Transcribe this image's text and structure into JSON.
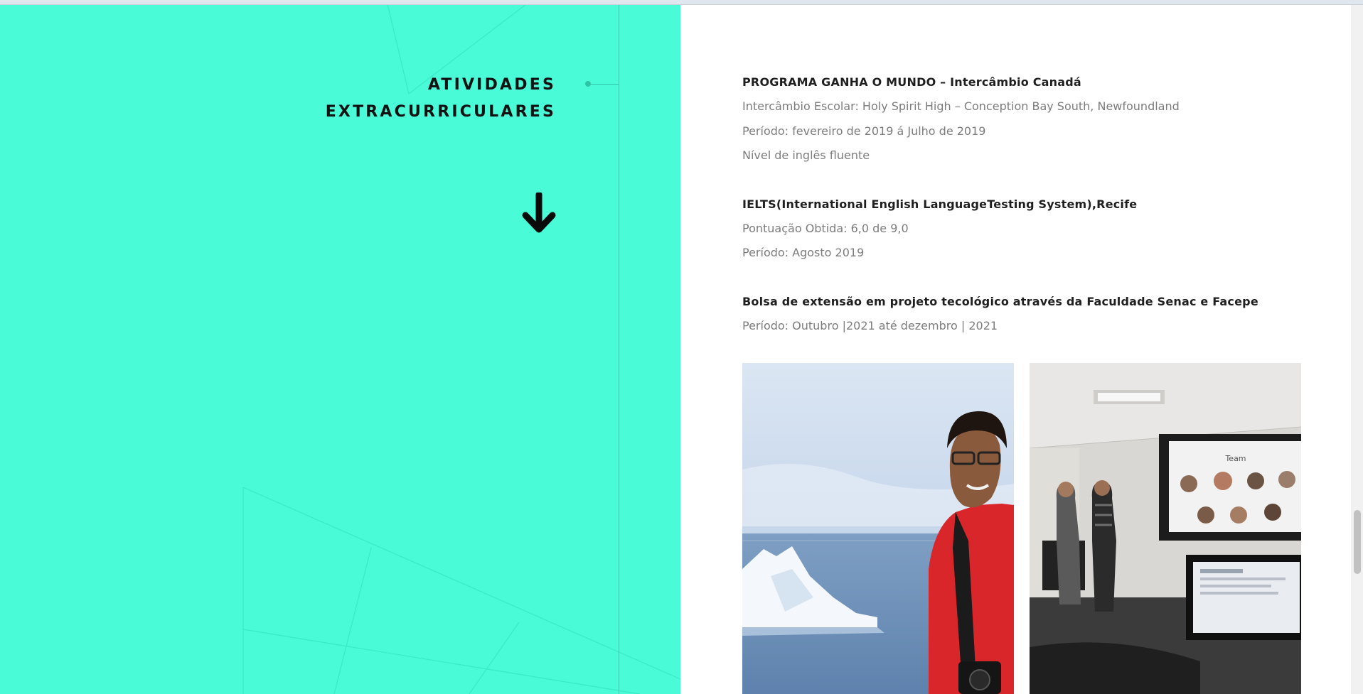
{
  "section": {
    "title_line1": "ATIVIDADES",
    "title_line2": "EXTRACURRICULARES",
    "arrow_icon": "arrow-down-icon"
  },
  "entries": [
    {
      "title": "PROGRAMA GANHA O MUNDO – Intercâmbio Canadá",
      "details": [
        "Intercâmbio Escolar: Holy Spirit High – Conception Bay South, Newfoundland",
        "Período: fevereiro de 2019 á Julho de 2019",
        "Nível de inglês fluente"
      ]
    },
    {
      "title": "IELTS(International English LanguageTesting System),Recife",
      "details": [
        "Pontuação Obtida: 6,0 de 9,0",
        "Período: Agosto 2019"
      ]
    },
    {
      "title": "Bolsa de extensão em projeto tecológico através da Faculdade Senac e Facepe",
      "details": [
        "Período: Outubro |2021 até dezembro | 2021"
      ]
    }
  ],
  "photos": {
    "presentation_screen_heading": "Team"
  },
  "colors": {
    "accent": "#49fbd7",
    "title_text": "#1f1f1f",
    "detail_text": "#7c7c7c"
  }
}
